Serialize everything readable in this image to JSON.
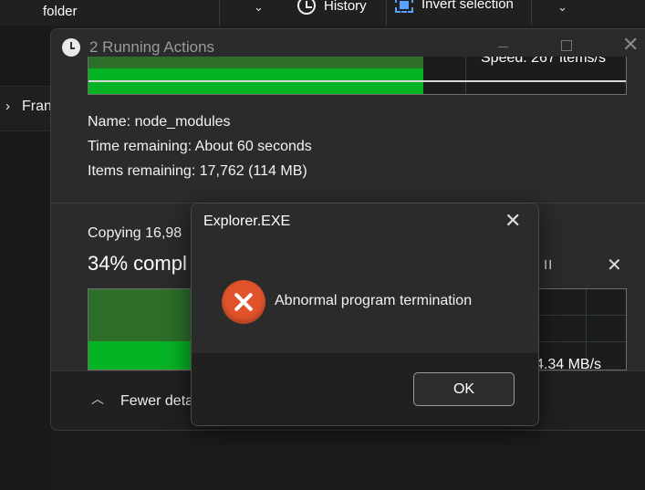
{
  "explorer": {
    "toolbar": {
      "folder_label": "folder",
      "history_label": "History",
      "invert_selection_label": "Invert selection",
      "chevron": "⌄"
    },
    "sidebar": {
      "item_label": "Fran",
      "chevron": "›"
    }
  },
  "running_actions": {
    "title": "2 Running Actions",
    "close_glyph": "✕",
    "action1": {
      "speed": "Speed: 267 items/s",
      "name_label": "Name:",
      "name_value": "node_modules",
      "time_label": "Time remaining:",
      "time_value": "About 60 seconds",
      "items_label": "Items remaining:",
      "items_value": "17,762 (114 MB)"
    },
    "action2": {
      "copying_text": "Copying 16,98",
      "percent_text": "34% compl",
      "progress_percent": 34,
      "speed": "4.34 MB/s",
      "pause_glyph": "II",
      "cancel_glyph": "✕"
    },
    "footer": {
      "fewer_details_label": "Fewer deta",
      "chevron": "︿"
    }
  },
  "error_dialog": {
    "title": "Explorer.EXE",
    "close_glyph": "✕",
    "message": "Abnormal program termination",
    "ok_label": "OK",
    "icon": "error-icon",
    "accent_color": "#e0532b"
  },
  "colors": {
    "progress_green": "#06b325",
    "progress_dark_green": "#2d6e2a",
    "background": "#1c1c1c"
  }
}
